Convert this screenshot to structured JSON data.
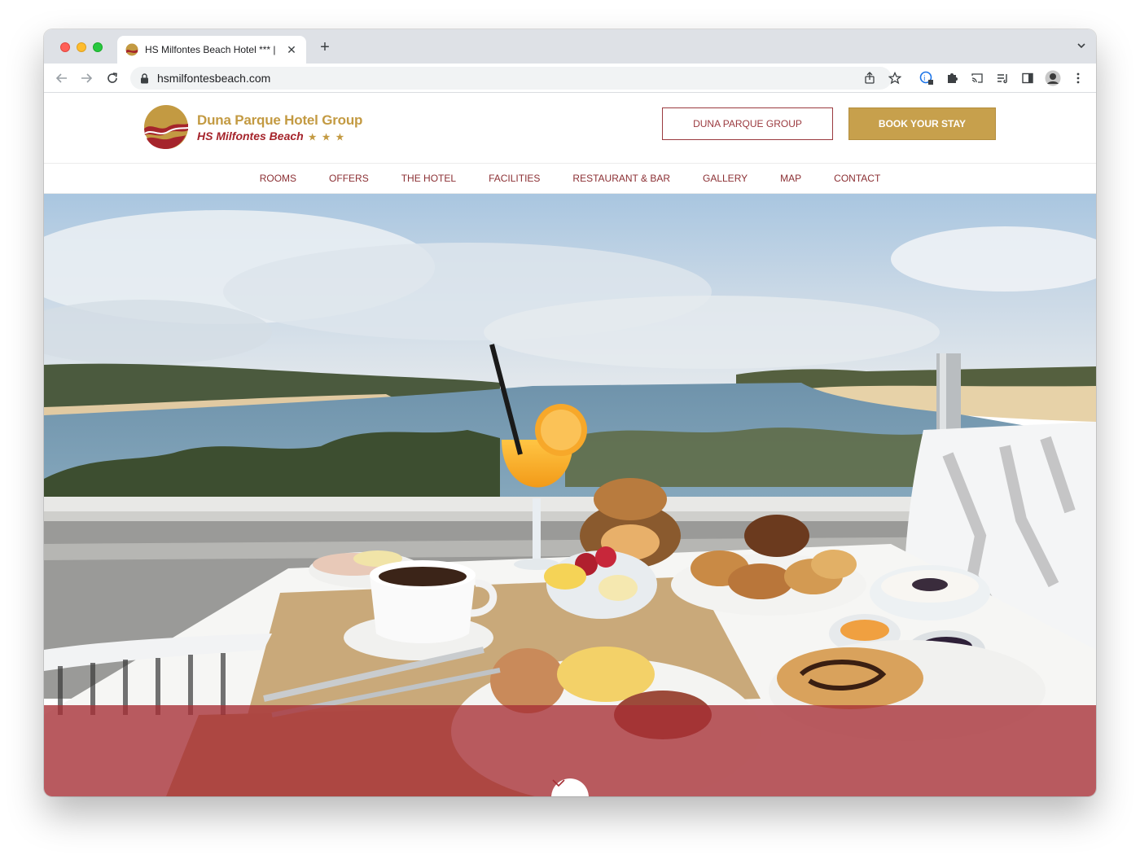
{
  "browser": {
    "tab_title": "HS Milfontes Beach Hotel *** |",
    "url": "hsmilfontesbeach.com"
  },
  "site": {
    "brand_name": "Duna Parque Hotel Group",
    "hotel_name": "HS Milfontes Beach",
    "stars": "★ ★ ★",
    "group_button": "DUNA PARQUE GROUP",
    "book_button": "BOOK YOUR STAY",
    "nav": [
      "ROOMS",
      "OFFERS",
      "THE HOTEL",
      "FACILITIES",
      "RESTAURANT & BAR",
      "GALLERY",
      "MAP",
      "CONTACT"
    ]
  },
  "colors": {
    "brand_gold": "#c7a04c",
    "brand_red": "#a5242b",
    "nav_text": "#8b2f33",
    "hero_band": "#a62e34"
  },
  "icons": [
    "back-arrow-icon",
    "forward-arrow-icon",
    "reload-icon",
    "lock-icon",
    "share-icon",
    "star-bookmark-icon",
    "extension-icon",
    "puzzle-icon",
    "cast-icon",
    "reading-list-icon",
    "sidepanel-icon",
    "profile-avatar-icon",
    "menu-dots-icon",
    "chevron-down-icon"
  ]
}
